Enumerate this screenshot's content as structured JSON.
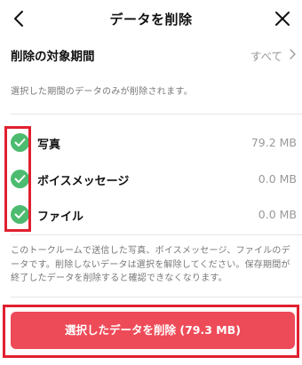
{
  "header": {
    "title": "データを削除",
    "back_icon": "chevron-left-icon",
    "close_icon": "close-icon"
  },
  "period": {
    "label": "削除の対象期間",
    "value": "すべて",
    "note": "選択した期間のデータのみが削除されます。"
  },
  "items": [
    {
      "label": "写真",
      "size": "79.2 MB",
      "checked": true
    },
    {
      "label": "ボイスメッセージ",
      "size": "0.0 MB",
      "checked": true
    },
    {
      "label": "ファイル",
      "size": "0.0 MB",
      "checked": true
    }
  ],
  "description": "このトークルームで送信した写真、ボイスメッセージ、ファイルのデータです。削除しないデータは選択を解除してください。保存期間が終了したデータを削除すると確認できなくなります。",
  "delete_button": {
    "label": "選択したデータを削除 (79.3 MB)"
  },
  "colors": {
    "check": "#4dbb6f",
    "button": "#ee4b58",
    "highlight": "#e0202f"
  }
}
